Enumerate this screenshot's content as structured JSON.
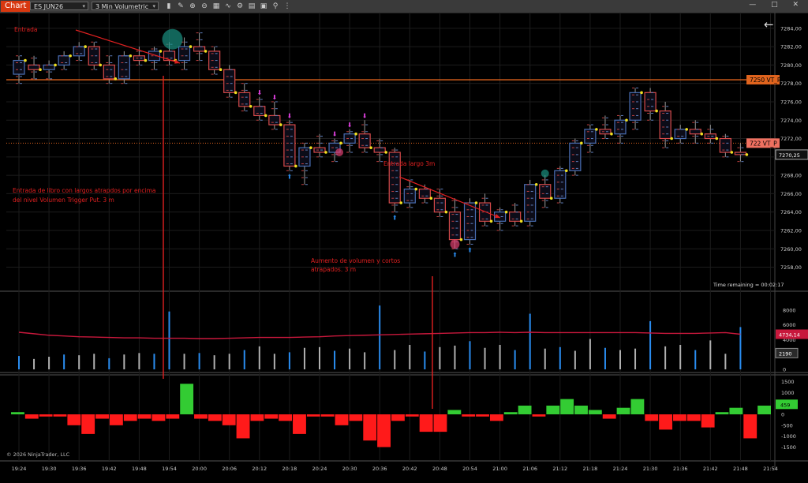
{
  "toolbar": {
    "chart_tab": "Chart",
    "instrument": "ES JUN26",
    "interval": "3 Min Volumetric",
    "icons": [
      "bar-type-icon",
      "draw-icon",
      "zoom-in-icon",
      "zoom-out-icon",
      "properties-icon",
      "indicators-icon",
      "strategies-icon",
      "templates-icon",
      "data-box-icon",
      "pin-icon",
      "more-icon"
    ],
    "window_controls": "— □ ✕"
  },
  "colors": {
    "background": "#000000",
    "up_candle": "#4a6fb5",
    "down_candle": "#d84a4a",
    "vt_line": "#e0641e",
    "annotation": "#e02020",
    "volume_bar": "#b0b0b0",
    "volume_highlight": "#2a8df0",
    "volume_avg": "#c8183c",
    "delta_pos": "#33cc33",
    "delta_neg": "#ff1a1a",
    "grid": "#1c1c1c"
  },
  "annotations": {
    "entrada": "Entrada",
    "entrada_libro": [
      "Entrada de libro con largos atrapdos por encima",
      "del nivel Volumen Trigger Put. 3 m"
    ],
    "entrada_largo": "Entrada largo 3m",
    "aumento": [
      "Aumento de volumen y cortos",
      "atrapados. 3 m"
    ]
  },
  "labels": {
    "vt_upper": "7250 VT_P",
    "vt_lower": "722 VT_P",
    "last_price": "7270,25",
    "volume_last": "2190",
    "volume_avg_last": "4734,14",
    "delta_last": "459",
    "time_remaining": "Time remaining = 00:02:17",
    "copyright": "© 2026 NinjaTrader, LLC",
    "back_arrow": "←"
  },
  "chart_data": [
    {
      "type": "candlestick",
      "title": "",
      "instrument": "ES JUN26",
      "interval": "3 Min Volumetric",
      "x_ticks": [
        "19:24",
        "19:30",
        "19:36",
        "19:42",
        "19:48",
        "19:54",
        "20:00",
        "20:06",
        "20:12",
        "20:18",
        "20:24",
        "20:30",
        "20:36",
        "20:42",
        "20:48",
        "20:54",
        "21:00",
        "21:06",
        "21:12",
        "21:18",
        "21:24",
        "21:30",
        "21:36",
        "21:42",
        "21:48",
        "21:54"
      ],
      "y_ticks": [
        "7258,00",
        "7260,00",
        "7262,00",
        "7264,00",
        "7266,00",
        "7268,00",
        "7270,00",
        "7272,00",
        "7274,00",
        "7276,00",
        "7278,00",
        "7280,00",
        "7282,00",
        "7284,00"
      ],
      "ylim": [
        7256.5,
        7284.5
      ],
      "levels": [
        {
          "name": "7250 VT_P",
          "value": 7278.4,
          "style": "solid"
        },
        {
          "name": "722 VT_P",
          "value": 7271.5,
          "style": "dotted"
        }
      ],
      "candles": [
        {
          "t": "19:24",
          "o": 7279.0,
          "h": 7281.0,
          "l": 7278.0,
          "c": 7280.5
        },
        {
          "t": "19:27",
          "o": 7280.0,
          "h": 7281.0,
          "l": 7278.5,
          "c": 7279.5
        },
        {
          "t": "19:30",
          "o": 7279.5,
          "h": 7280.5,
          "l": 7278.5,
          "c": 7280.0
        },
        {
          "t": "19:33",
          "o": 7280.0,
          "h": 7281.5,
          "l": 7279.5,
          "c": 7281.0
        },
        {
          "t": "19:36",
          "o": 7281.0,
          "h": 7282.5,
          "l": 7280.5,
          "c": 7282.0
        },
        {
          "t": "19:39",
          "o": 7282.0,
          "h": 7282.5,
          "l": 7279.5,
          "c": 7280.0
        },
        {
          "t": "19:42",
          "o": 7280.0,
          "h": 7281.0,
          "l": 7278.0,
          "c": 7278.5
        },
        {
          "t": "19:45",
          "o": 7278.5,
          "h": 7281.5,
          "l": 7278.0,
          "c": 7281.0
        },
        {
          "t": "19:48",
          "o": 7281.0,
          "h": 7282.0,
          "l": 7280.0,
          "c": 7280.5
        },
        {
          "t": "19:51",
          "o": 7280.5,
          "h": 7282.0,
          "l": 7279.5,
          "c": 7281.5
        },
        {
          "t": "19:54",
          "o": 7281.5,
          "h": 7282.5,
          "l": 7280.0,
          "c": 7280.5
        },
        {
          "t": "19:57",
          "o": 7280.5,
          "h": 7283.0,
          "l": 7279.5,
          "c": 7282.0
        },
        {
          "t": "20:00",
          "o": 7282.0,
          "h": 7283.5,
          "l": 7280.5,
          "c": 7281.5
        },
        {
          "t": "20:03",
          "o": 7281.5,
          "h": 7282.0,
          "l": 7279.0,
          "c": 7279.5
        },
        {
          "t": "20:06",
          "o": 7279.5,
          "h": 7280.0,
          "l": 7276.5,
          "c": 7277.0
        },
        {
          "t": "20:09",
          "o": 7277.0,
          "h": 7278.0,
          "l": 7275.0,
          "c": 7275.5
        },
        {
          "t": "20:12",
          "o": 7275.5,
          "h": 7276.5,
          "l": 7274.0,
          "c": 7274.5
        },
        {
          "t": "20:15",
          "o": 7274.5,
          "h": 7276.0,
          "l": 7273.0,
          "c": 7273.5
        },
        {
          "t": "20:18",
          "o": 7273.5,
          "h": 7274.0,
          "l": 7268.5,
          "c": 7269.0
        },
        {
          "t": "20:21",
          "o": 7269.0,
          "h": 7271.5,
          "l": 7267.0,
          "c": 7271.0
        },
        {
          "t": "20:24",
          "o": 7271.0,
          "h": 7272.5,
          "l": 7270.0,
          "c": 7270.5
        },
        {
          "t": "20:27",
          "o": 7270.5,
          "h": 7272.0,
          "l": 7269.5,
          "c": 7271.5
        },
        {
          "t": "20:30",
          "o": 7271.5,
          "h": 7273.0,
          "l": 7270.5,
          "c": 7272.5
        },
        {
          "t": "20:33",
          "o": 7272.5,
          "h": 7274.0,
          "l": 7270.5,
          "c": 7271.0
        },
        {
          "t": "20:36",
          "o": 7271.0,
          "h": 7272.0,
          "l": 7269.5,
          "c": 7270.5
        },
        {
          "t": "20:39",
          "o": 7270.5,
          "h": 7271.0,
          "l": 7264.0,
          "c": 7265.0
        },
        {
          "t": "20:42",
          "o": 7265.0,
          "h": 7267.5,
          "l": 7264.5,
          "c": 7266.5
        },
        {
          "t": "20:45",
          "o": 7266.5,
          "h": 7267.0,
          "l": 7265.0,
          "c": 7265.5
        },
        {
          "t": "20:48",
          "o": 7265.5,
          "h": 7266.5,
          "l": 7263.5,
          "c": 7264.0
        },
        {
          "t": "20:51",
          "o": 7264.0,
          "h": 7265.5,
          "l": 7260.0,
          "c": 7261.0
        },
        {
          "t": "20:54",
          "o": 7261.0,
          "h": 7265.5,
          "l": 7260.5,
          "c": 7265.0
        },
        {
          "t": "20:57",
          "o": 7265.0,
          "h": 7266.0,
          "l": 7262.5,
          "c": 7263.0
        },
        {
          "t": "21:00",
          "o": 7263.0,
          "h": 7264.5,
          "l": 7262.0,
          "c": 7264.0
        },
        {
          "t": "21:03",
          "o": 7264.0,
          "h": 7265.0,
          "l": 7262.5,
          "c": 7263.0
        },
        {
          "t": "21:06",
          "o": 7263.0,
          "h": 7267.5,
          "l": 7262.5,
          "c": 7267.0
        },
        {
          "t": "21:09",
          "o": 7267.0,
          "h": 7268.0,
          "l": 7264.5,
          "c": 7265.5
        },
        {
          "t": "21:12",
          "o": 7265.5,
          "h": 7269.0,
          "l": 7265.0,
          "c": 7268.5
        },
        {
          "t": "21:15",
          "o": 7268.5,
          "h": 7272.0,
          "l": 7268.0,
          "c": 7271.5
        },
        {
          "t": "21:18",
          "o": 7271.5,
          "h": 7273.5,
          "l": 7270.5,
          "c": 7273.0
        },
        {
          "t": "21:21",
          "o": 7273.0,
          "h": 7274.5,
          "l": 7272.0,
          "c": 7272.5
        },
        {
          "t": "21:24",
          "o": 7272.5,
          "h": 7274.5,
          "l": 7271.5,
          "c": 7274.0
        },
        {
          "t": "21:27",
          "o": 7274.0,
          "h": 7277.5,
          "l": 7273.0,
          "c": 7277.0
        },
        {
          "t": "21:30",
          "o": 7277.0,
          "h": 7277.5,
          "l": 7274.0,
          "c": 7275.0
        },
        {
          "t": "21:33",
          "o": 7275.0,
          "h": 7276.0,
          "l": 7271.0,
          "c": 7272.0
        },
        {
          "t": "21:36",
          "o": 7272.0,
          "h": 7273.5,
          "l": 7271.5,
          "c": 7273.0
        },
        {
          "t": "21:39",
          "o": 7273.0,
          "h": 7274.0,
          "l": 7271.5,
          "c": 7272.5
        },
        {
          "t": "21:42",
          "o": 7272.5,
          "h": 7273.5,
          "l": 7271.5,
          "c": 7272.0
        },
        {
          "t": "21:45",
          "o": 7272.0,
          "h": 7272.5,
          "l": 7270.0,
          "c": 7270.5
        },
        {
          "t": "21:48",
          "o": 7270.5,
          "h": 7271.5,
          "l": 7269.5,
          "c": 7270.25
        }
      ]
    },
    {
      "type": "bar",
      "title": "",
      "y_ticks": [
        "0",
        "2000",
        "4000",
        "6000",
        "8000"
      ],
      "ylim": [
        0,
        10000
      ],
      "volume": [
        1800,
        1400,
        1700,
        2000,
        1900,
        2100,
        1500,
        2000,
        2200,
        2100,
        7800,
        2100,
        2200,
        1900,
        2100,
        2600,
        3100,
        2100,
        2300,
        2900,
        3000,
        2500,
        2800,
        2300,
        8600,
        2600,
        3300,
        2400,
        3000,
        3200,
        3800,
        2900,
        3300,
        2600,
        7500,
        2800,
        3000,
        2500,
        4100,
        2900,
        2600,
        2800,
        6500,
        3100,
        3300,
        2600,
        3900,
        2100,
        5700
      ],
      "highlight_every": 3,
      "average": [
        5000,
        4800,
        4600,
        4500,
        4400,
        4350,
        4300,
        4250,
        4250,
        4200,
        4200,
        4200,
        4150,
        4150,
        4200,
        4250,
        4300,
        4300,
        4300,
        4350,
        4400,
        4500,
        4550,
        4600,
        4650,
        4700,
        4750,
        4800,
        4850,
        4900,
        4950,
        4950,
        5000,
        4950,
        5000,
        4950,
        4950,
        4950,
        4950,
        4950,
        4950,
        4950,
        4900,
        4850,
        4850,
        4850,
        4900,
        4950,
        4734.14
      ]
    },
    {
      "type": "bar",
      "title": "",
      "y_ticks": [
        "1500",
        "1000",
        "500",
        "0",
        "-500",
        "-1000",
        "-1500"
      ],
      "ylim": [
        -1700,
        1700
      ],
      "delta": [
        100,
        -200,
        -100,
        -100,
        -500,
        -900,
        -200,
        -500,
        -300,
        -200,
        -300,
        -200,
        1400,
        -200,
        -300,
        -500,
        -1100,
        -300,
        -200,
        -300,
        -900,
        -100,
        -100,
        -500,
        -300,
        -1200,
        -1500,
        -300,
        -100,
        -800,
        -800,
        200,
        -100,
        -100,
        -300,
        100,
        400,
        -100,
        400,
        700,
        400,
        200,
        -200,
        300,
        700,
        -300,
        -700,
        -300,
        -300,
        -600,
        100,
        300,
        -1100,
        400
      ]
    }
  ]
}
